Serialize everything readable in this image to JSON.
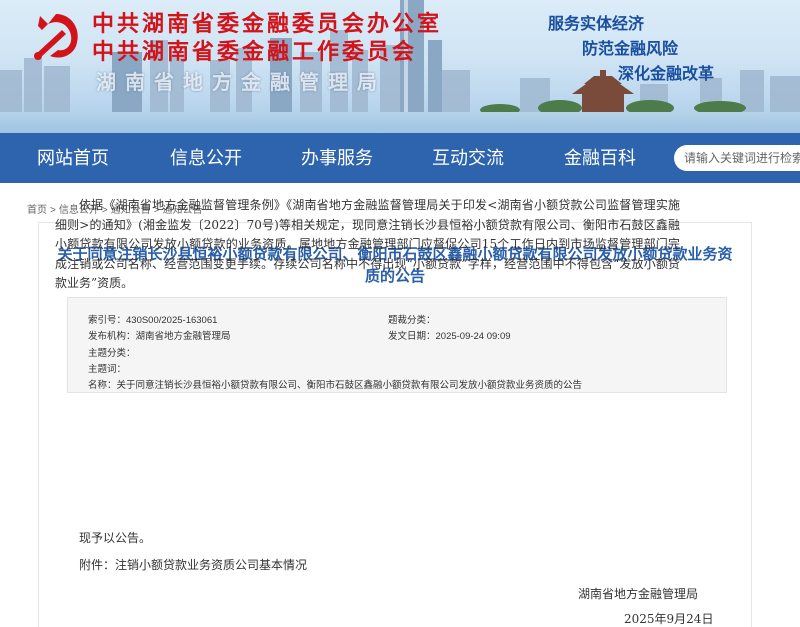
{
  "header": {
    "title_line1": "中共湖南省委金融委员会办公室",
    "title_line2": "中共湖南省委金融工作委员会",
    "title_line3": "湖南省地方金融管理局",
    "slogans": [
      "服务实体经济",
      "防范金融风险",
      "深化金融改革"
    ],
    "brand_red": "#d2131a",
    "slogan_blue": "#1a4fa0",
    "emblem_icon": "party-emblem-icon"
  },
  "nav": {
    "items": [
      "网站首页",
      "信息公开",
      "办事服务",
      "互动交流",
      "金融百科"
    ],
    "background": "#2d64ad",
    "search_placeholder": "请输入关键词进行检索"
  },
  "breadcrumb": [
    "首页",
    "信息公开",
    "通知公告",
    "通知公告"
  ],
  "article": {
    "title": "关于同意注销长沙县恒裕小额贷款有限公司、衡阳市石鼓区鑫融小额贷款有限公司发放小额贷款业务资质的公告",
    "title_color": "#2a5fa8",
    "meta": {
      "index_no": "索引号：430S00/2025-163061",
      "category": "题裁分类：",
      "publisher": "发布机构：湖南省地方金融管理局",
      "publish_date": "发文日期：2025-09-24 09:09",
      "subject_class": "主题分类：",
      "subject_words": "主题词：",
      "name": "名称：关于同意注销长沙县恒裕小额贷款有限公司、衡阳市石鼓区鑫融小额贷款有限公司发放小额贷款业务资质的公告"
    },
    "paragraph": "依据《湖南省地方金融监督管理条例》《湖南省地方金融监督管理局关于印发<湖南省小额贷款公司监督管理实施细则>的通知》(湘金监发〔2022〕70号)等相关规定，现同意注销长沙县恒裕小额贷款有限公司、衡阳市石鼓区鑫融小额贷款有限公司发放小额贷款的业务资质。属地地方金融管理部门应督促公司15个工作日内到市场监督管理部门完成注销或公司名称、经营范围变更手续。存续公司名称中不得出现“小额贷款”字样，经营范围中不得包含“发放小额贷款业务”资质。",
    "notice_line": "现予以公告。",
    "attachment": "附件：注销小额贷款业务资质公司基本情况",
    "signature": "湖南省地方金融管理局",
    "date": "2025年9月24日"
  }
}
